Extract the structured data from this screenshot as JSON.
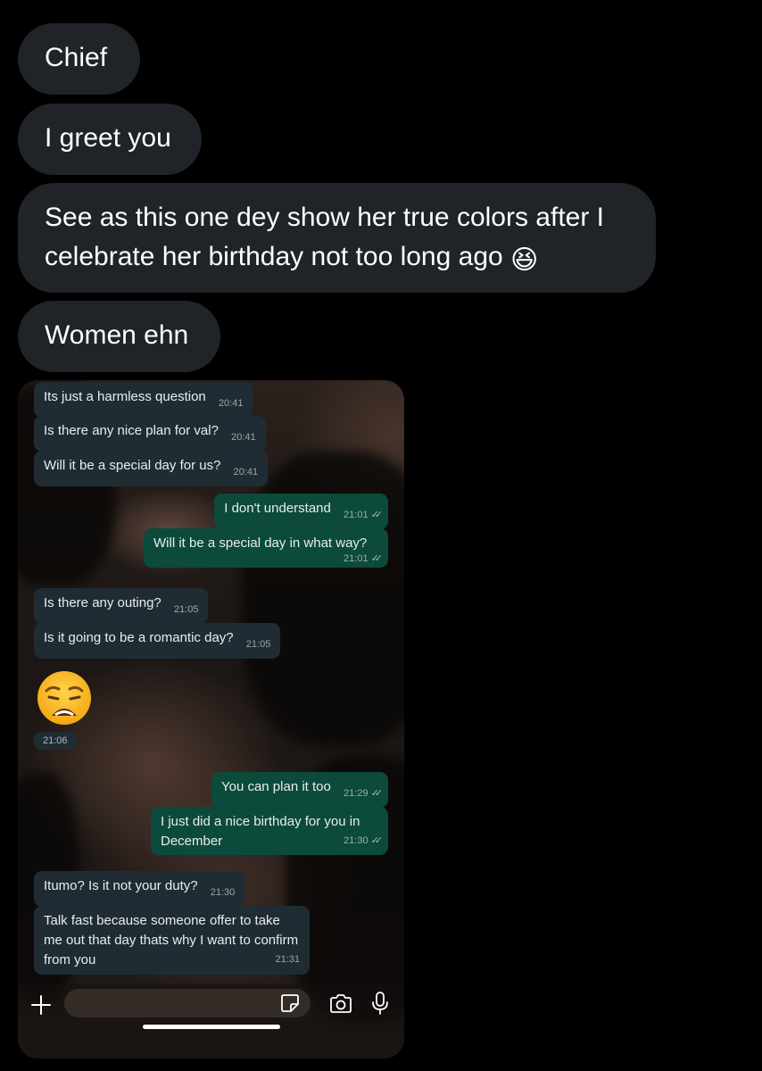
{
  "dm_messages": [
    {
      "text": "Chief"
    },
    {
      "text": "I greet you"
    },
    {
      "text": "See as this one dey show her true colors after I celebrate her birthday not too long ago",
      "emoji": "😆"
    },
    {
      "text": "Women ehn"
    }
  ],
  "chat": {
    "messages": [
      {
        "direction": "incoming",
        "text": "Its just a harmless question",
        "time": "20:41"
      },
      {
        "direction": "incoming",
        "text": "Is there any nice plan for val?",
        "time": "20:41"
      },
      {
        "direction": "incoming",
        "text": "Will it be a special day for us?",
        "time": "20:41"
      },
      {
        "direction": "outgoing",
        "text": "I don't understand",
        "time": "21:01",
        "status": "read"
      },
      {
        "direction": "outgoing",
        "text": "Will it be a special day in what way?",
        "time": "21:01",
        "status": "read"
      },
      {
        "direction": "incoming",
        "text": "Is there any outing?",
        "time": "21:05"
      },
      {
        "direction": "incoming",
        "text": "Is it going to be a romantic day?",
        "time": "21:05"
      },
      {
        "direction": "incoming",
        "text": "",
        "emoji": "weary-face",
        "time": "21:06"
      },
      {
        "direction": "outgoing",
        "text": "You can plan it too",
        "time": "21:29",
        "status": "read"
      },
      {
        "direction": "outgoing",
        "text": "I just did a nice birthday for you in December",
        "time": "21:30",
        "status": "read"
      },
      {
        "direction": "incoming",
        "text": "Itumo? Is it not your duty?",
        "time": "21:30"
      },
      {
        "direction": "incoming",
        "text": "Talk fast because someone offer to take me out that day thats why I want to confirm from you",
        "time": "21:31"
      }
    ],
    "input": {
      "placeholder": ""
    },
    "icons": {
      "attach": "plus-icon",
      "sticker": "sticker-icon",
      "camera": "camera-icon",
      "voice": "microphone-icon"
    },
    "colors": {
      "incoming_bubble": "#202c33",
      "outgoing_bubble": "#0c4a3c",
      "dm_bubble": "#202327"
    }
  }
}
